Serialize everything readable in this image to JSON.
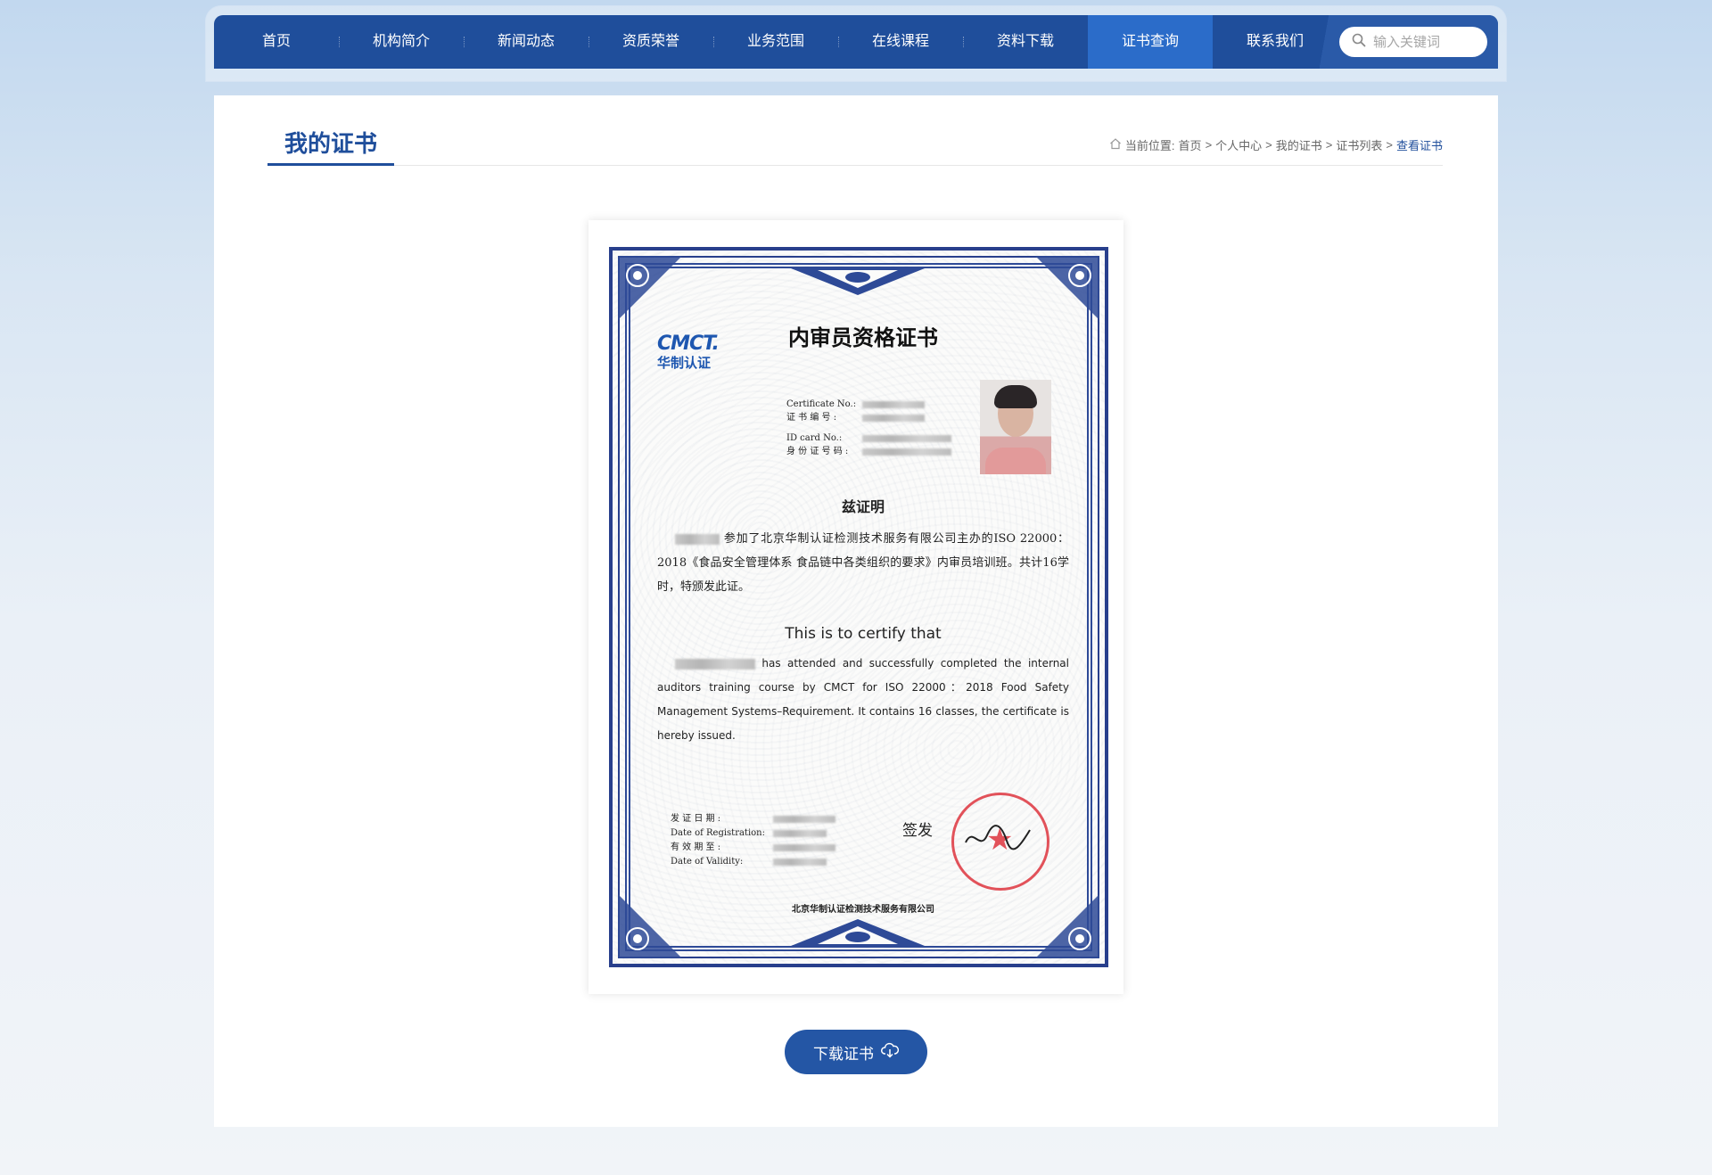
{
  "nav": {
    "items": [
      {
        "label": "首页"
      },
      {
        "label": "机构简介"
      },
      {
        "label": "新闻动态"
      },
      {
        "label": "资质荣誉"
      },
      {
        "label": "业务范围"
      },
      {
        "label": "在线课程"
      },
      {
        "label": "资料下载"
      },
      {
        "label": "证书查询"
      },
      {
        "label": "联系我们"
      }
    ],
    "active_index": 7,
    "search_placeholder": "输入关键词"
  },
  "page": {
    "title": "我的证书",
    "breadcrumb": {
      "prefix": "当前位置:",
      "items": [
        "首页",
        "个人中心",
        "我的证书",
        "证书列表"
      ],
      "current": "查看证书",
      "separator": ">"
    }
  },
  "certificate": {
    "logo_en": "CMCT.",
    "logo_cn": "华制认证",
    "title": "内审员资格证书",
    "cert_no_label_en": "Certificate No.:",
    "cert_no_label_cn": "证 书 编 号 :",
    "id_label_en": "ID   card No.:",
    "id_label_cn": "身 份 证 号 码 :",
    "certify_cn": "兹证明",
    "body_cn": "参加了北京华制认证检测技术服务有限公司主办的ISO 22000：2018《食品安全管理体系 食品链中各类组织的要求》内审员培训班。共计16学时，特颁发此证。",
    "certify_en": "This is to certify that",
    "body_en": "has attended and successfully completed the internal auditors training course by CMCT for ISO 22000：2018 Food Safety Management Systems–Requirement. It contains 16 classes, the certificate is hereby issued.",
    "issue_date_label_cn": "发  证  日  期 :",
    "issue_date_label_en": "Date of Registration:",
    "validity_label_cn": "有  效  期  至 :",
    "validity_label_en": "Date   of   Validity:",
    "sign_label": "签发",
    "issuer": "北京华制认证检测技术服务有限公司"
  },
  "download_button": {
    "label": "下载证书",
    "icon": "cloud-download-icon"
  },
  "colors": {
    "nav_bg": "#1f4e9b",
    "nav_active": "#2b6cc9",
    "accent": "#1f4e9b",
    "button": "#2456a5",
    "seal": "#dc2832"
  }
}
